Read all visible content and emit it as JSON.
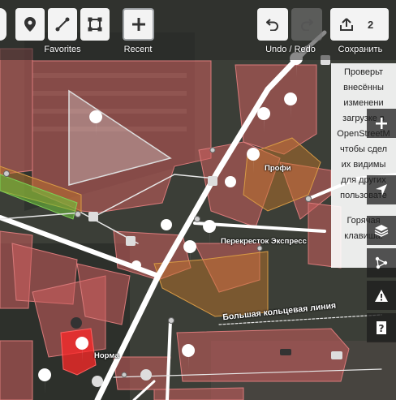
{
  "toolbar": {
    "favorites_label": "Favorites",
    "recent_label": "Recent",
    "undo_redo_label": "Undo / Redo",
    "save_label": "Сохранить",
    "save_count": "2"
  },
  "side_panel": {
    "lines": [
      "Проверьт",
      "внесённы",
      "изменени",
      "загрузке в",
      "OpenStreetM",
      "чтобы сдел",
      "их видимы",
      "для других",
      "пользовате"
    ],
    "hotkey_lines": [
      "Горячая",
      "клавиша:"
    ]
  },
  "map_labels": {
    "profi": "Профи",
    "perekrestok": "Перекресток Экспресс",
    "norma": "Норма",
    "ring_line": "Большая кольцевая линия"
  },
  "icons": {
    "point": "point-icon",
    "line": "line-icon",
    "area": "area-icon",
    "add": "plus-icon",
    "undo": "undo-icon",
    "redo": "redo-icon",
    "upload": "upload-icon",
    "zoom_in": "plus-icon",
    "geolocate": "locate-arrow-icon",
    "layers": "layers-icon",
    "map_data": "map-data-icon",
    "issues": "warning-icon",
    "help": "help-icon"
  }
}
